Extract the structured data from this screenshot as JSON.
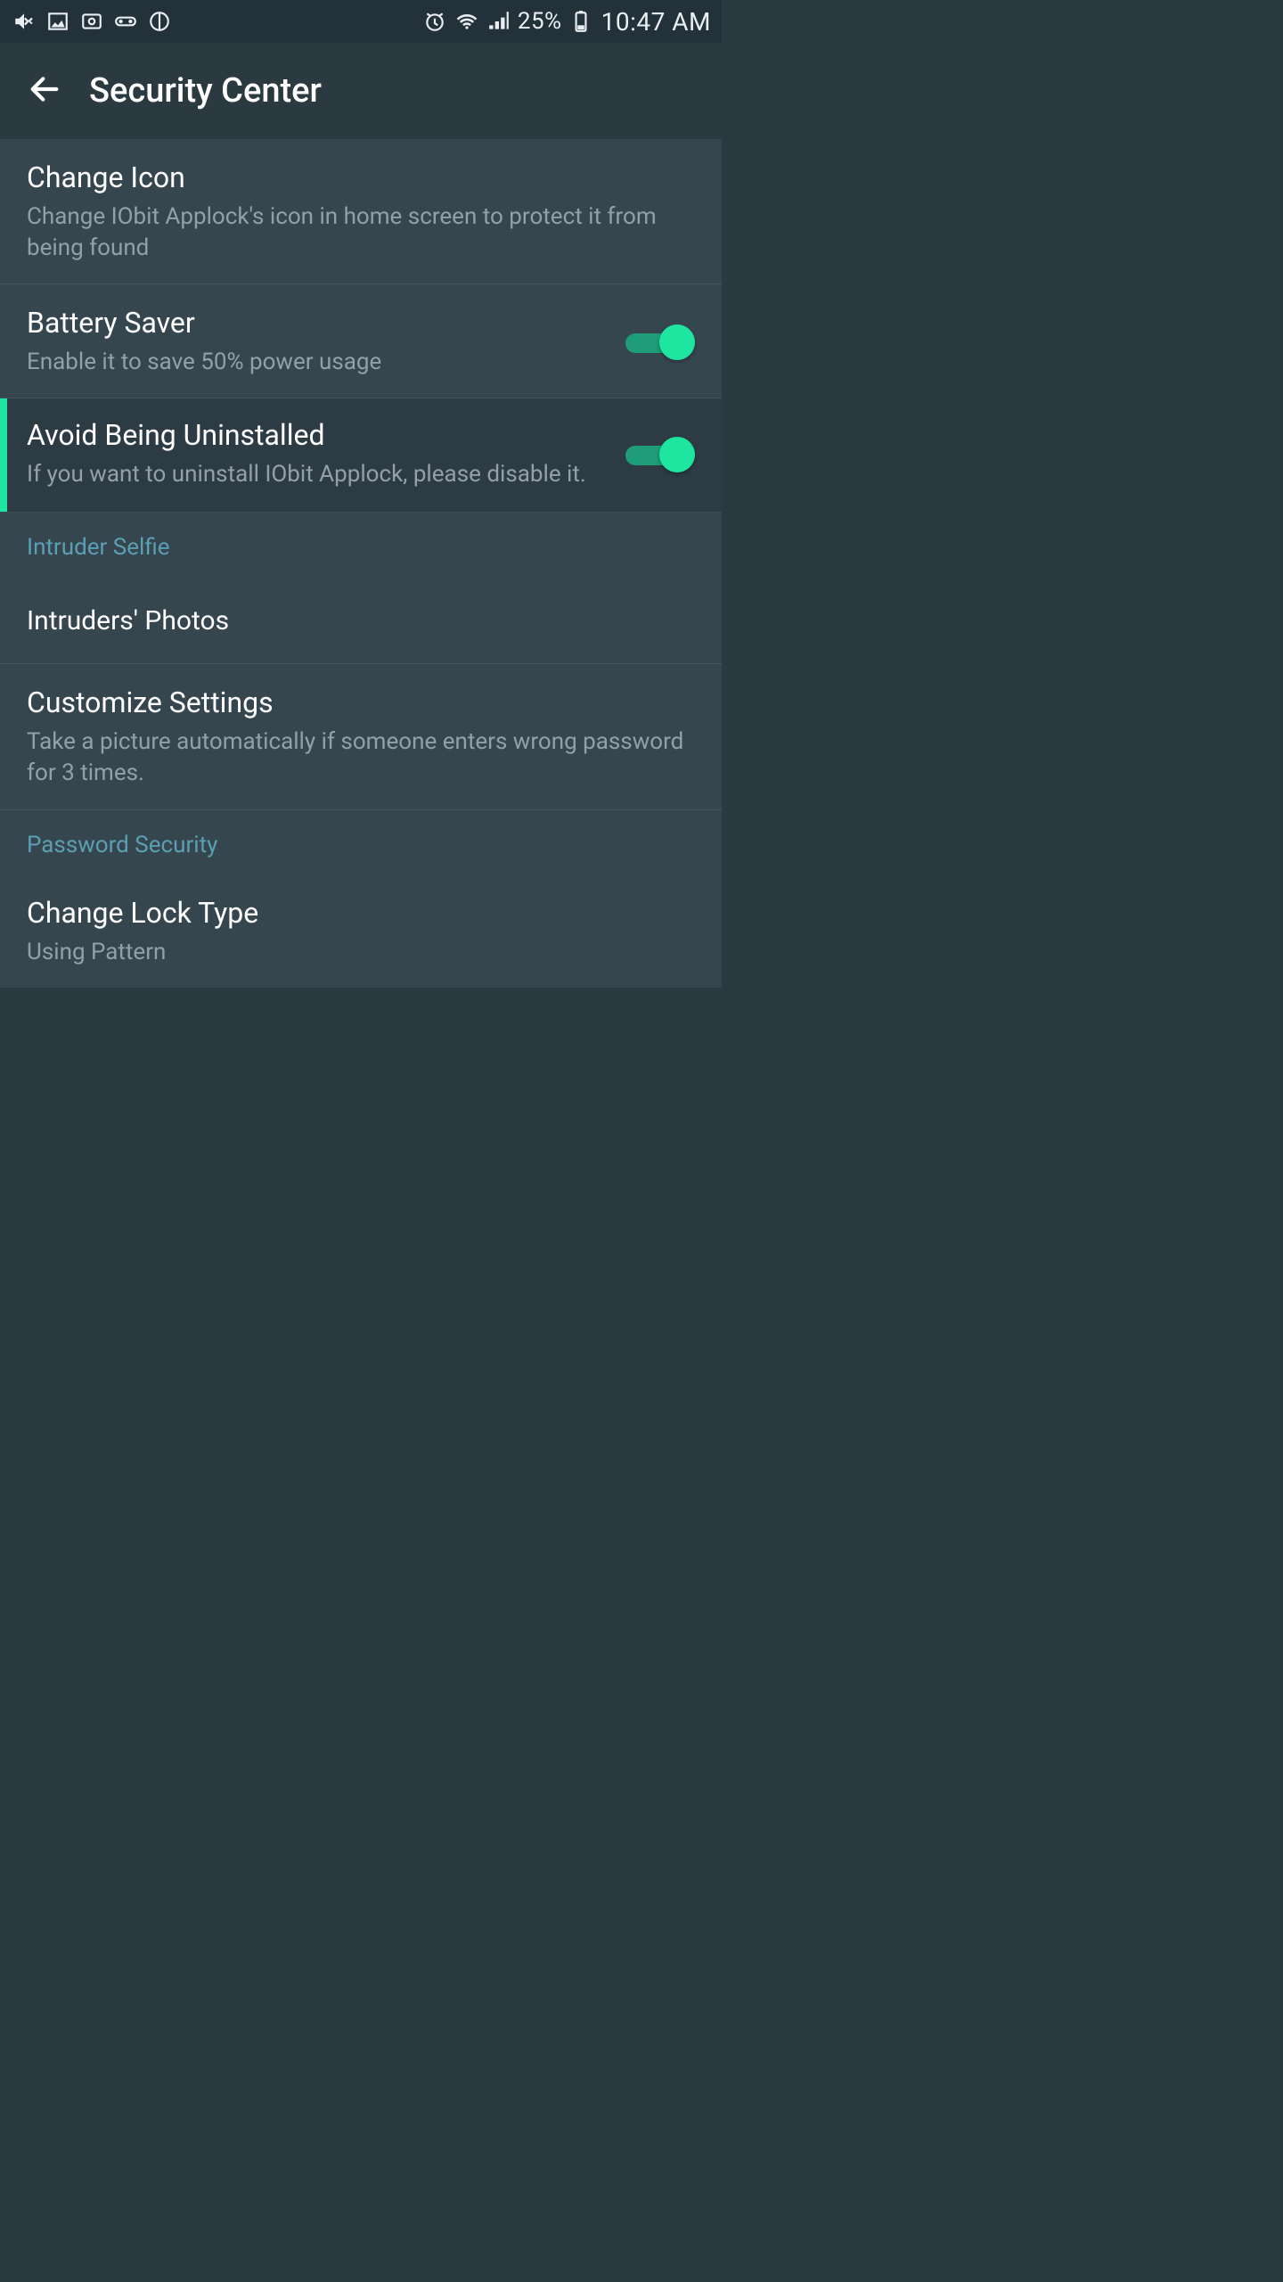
{
  "status": {
    "battery": "25%",
    "time": "10:47 AM"
  },
  "header": {
    "title": "Security Center"
  },
  "items": {
    "change_icon": {
      "title": "Change Icon",
      "desc": "Change IObit Applock's icon in home screen to protect it from being found"
    },
    "battery_saver": {
      "title": "Battery Saver",
      "desc": "Enable it to save 50% power usage",
      "toggled": true
    },
    "avoid_uninstall": {
      "title": "Avoid Being Uninstalled",
      "desc": "If you want to uninstall IObit Applock, please disable it.",
      "toggled": true
    },
    "intruders_photos": {
      "title": "Intruders' Photos"
    },
    "customize_settings": {
      "title": "Customize Settings",
      "desc": "Take a picture automatically if someone enters wrong password for 3 times."
    },
    "change_lock_type": {
      "title": "Change Lock Type",
      "desc": "Using Pattern"
    }
  },
  "sections": {
    "intruder_selfie": "Intruder Selfie",
    "password_security": "Password Security"
  }
}
